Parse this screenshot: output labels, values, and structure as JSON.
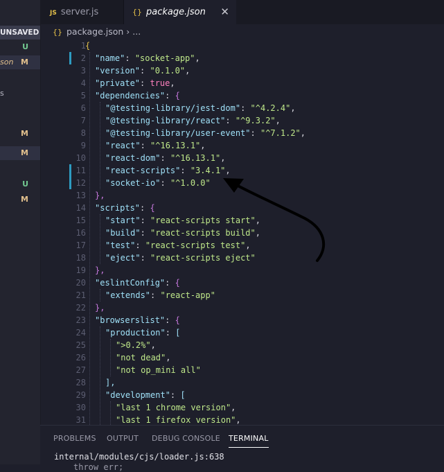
{
  "sidebar": {
    "unsaved_label": "UNSAVED",
    "rows": [
      {
        "text": "",
        "status": "U"
      },
      {
        "text": "son",
        "status": "M"
      },
      {
        "text": "s",
        "status": ""
      },
      {
        "text": "",
        "status": "M"
      },
      {
        "text": "",
        "status": "M"
      },
      {
        "text": "",
        "status": "U"
      },
      {
        "text": "",
        "status": "M"
      }
    ]
  },
  "tabs": [
    {
      "icon": "JS",
      "label": "server.js"
    },
    {
      "icon": "{}",
      "label": "package.json",
      "close": "✕"
    }
  ],
  "breadcrumb": {
    "icon": "{}",
    "file": "package.json",
    "sep": "›",
    "more": "..."
  },
  "editor": {
    "line_numbers": [
      "1",
      "2",
      "3",
      "4",
      "5",
      "6",
      "7",
      "8",
      "9",
      "10",
      "11",
      "12",
      "13",
      "14",
      "15",
      "16",
      "17",
      "18",
      "19",
      "20",
      "21",
      "22",
      "23",
      "24",
      "25",
      "26",
      "27",
      "28",
      "29",
      "30",
      "31"
    ]
  },
  "code": {
    "l1": "{",
    "l2k": "\"name\"",
    "l2v": "\"socket-app\"",
    "l3k": "\"version\"",
    "l3v": "\"0.1.0\"",
    "l4k": "\"private\"",
    "l4v": "true",
    "l5k": "\"dependencies\"",
    "l5b": "{",
    "l6k": "\"@testing-library/jest-dom\"",
    "l6v": "\"^4.2.4\"",
    "l7k": "\"@testing-library/react\"",
    "l7v": "\"^9.3.2\"",
    "l8k": "\"@testing-library/user-event\"",
    "l8v": "\"^7.1.2\"",
    "l9k": "\"react\"",
    "l9v": "\"^16.13.1\"",
    "l10k": "\"react-dom\"",
    "l10v": "\"^16.13.1\"",
    "l11k": "\"react-scripts\"",
    "l11v": "\"3.4.1\"",
    "l12k": "\"socket-io\"",
    "l12v": "\"^1.0.0\"",
    "l13": "},",
    "l14k": "\"scripts\"",
    "l14b": "{",
    "l15k": "\"start\"",
    "l15v": "\"react-scripts start\"",
    "l16k": "\"build\"",
    "l16v": "\"react-scripts build\"",
    "l17k": "\"test\"",
    "l17v": "\"react-scripts test\"",
    "l18k": "\"eject\"",
    "l18v": "\"react-scripts eject\"",
    "l19": "},",
    "l20k": "\"eslintConfig\"",
    "l20b": "{",
    "l21k": "\"extends\"",
    "l21v": "\"react-app\"",
    "l22": "},",
    "l23k": "\"browserslist\"",
    "l23b": "{",
    "l24k": "\"production\"",
    "l24b": "[",
    "l25v": "\">0.2%\"",
    "l26v": "\"not dead\"",
    "l27v": "\"not op_mini all\"",
    "l28": "],",
    "l29k": "\"development\"",
    "l29b": "[",
    "l30v": "\"last 1 chrome version\"",
    "l31v": "\"last 1 firefox version\""
  },
  "panel": {
    "tabs": [
      "PROBLEMS",
      "OUTPUT",
      "DEBUG CONSOLE",
      "TERMINAL"
    ],
    "active_tab": "TERMINAL",
    "terminal_line": "internal/modules/cjs/loader.js:638",
    "terminal_line2": "throw err;"
  },
  "colors": {
    "key": "#9fe0f7",
    "string": "#bfe88a",
    "keyword": "#ff80bf",
    "modified": "#e2c08d",
    "untracked": "#73c991",
    "accent": "#2e9bc1"
  }
}
